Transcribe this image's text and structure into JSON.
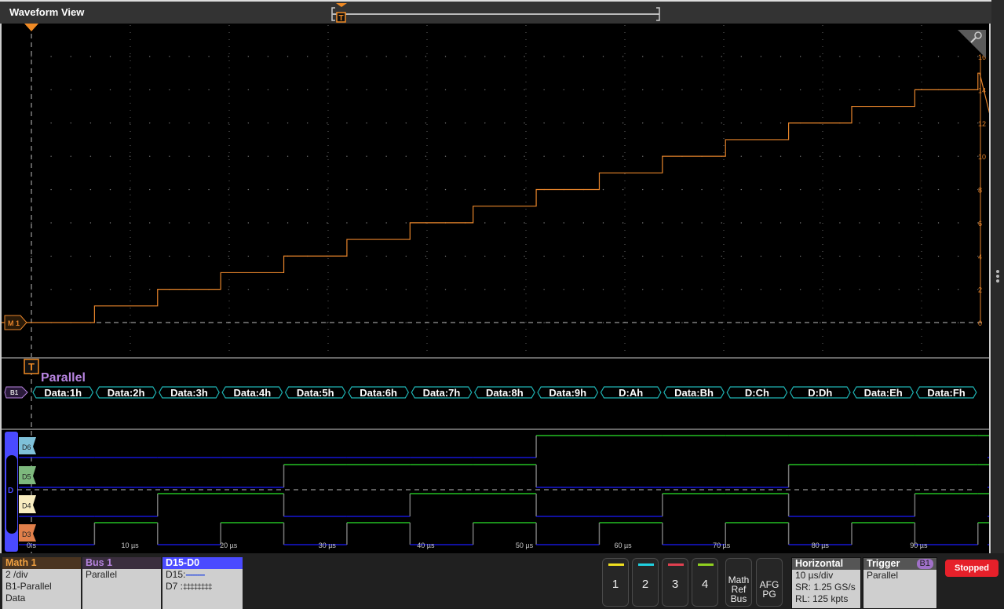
{
  "window": {
    "title": "Waveform View"
  },
  "colors": {
    "math": "#e8852b",
    "bus_label": "#b784e0",
    "bus_outline": "#1fb4b4",
    "digital_high": "#2be62b",
    "digital_low": "#1a1aff",
    "d_group": "#4a4aff"
  },
  "math_waveform": {
    "label": "M 1",
    "yaxis_ticks": [
      "0",
      "2",
      "4",
      "6",
      "8",
      "10",
      "12",
      "14",
      "16"
    ],
    "step_values": [
      0,
      1,
      2,
      3,
      4,
      5,
      6,
      7,
      8,
      9,
      10,
      11,
      12,
      13,
      14,
      15,
      0
    ],
    "step_period_us": 6.4,
    "start_us": 0
  },
  "bus": {
    "trigger_marker": "T",
    "title": "Parallel",
    "badge": "B1",
    "packets": [
      "Data:1h",
      "Data:2h",
      "Data:3h",
      "Data:4h",
      "Data:5h",
      "Data:6h",
      "Data:7h",
      "Data:8h",
      "Data:9h",
      "D:Ah",
      "Data:Bh",
      "D:Ch",
      "D:Dh",
      "Data:Eh",
      "Data:Fh"
    ]
  },
  "digital": {
    "group_label": "D",
    "channels": [
      {
        "name": "D6",
        "color": "#7ec0d8",
        "bit": 3
      },
      {
        "name": "D5",
        "color": "#7db87d",
        "bit": 2
      },
      {
        "name": "D4",
        "color": "#f8ecc0",
        "bit": 1
      },
      {
        "name": "D3",
        "color": "#e07f4a",
        "bit": 0
      }
    ]
  },
  "time_axis": {
    "labels": [
      "0 s",
      "10 µs",
      "20 µs",
      "30 µs",
      "40 µs",
      "50 µs",
      "60 µs",
      "70 µs",
      "80 µs",
      "90 µs"
    ],
    "us_per_div": 10
  },
  "badges": {
    "math": {
      "title": "Math 1",
      "lines": [
        "2 /div",
        "B1-Parallel",
        "Data"
      ]
    },
    "bus": {
      "title": "Bus 1",
      "lines": [
        "Parallel"
      ]
    },
    "digital": {
      "title": "D15-D0",
      "line1": "D15:",
      "line1_value": "--------",
      "line2": "D7 :",
      "line2_value": "‡‡‡‡‡‡‡‡"
    },
    "horizontal": {
      "title": "Horizontal",
      "lines": [
        "10 µs/div",
        "SR: 1.25 GS/s",
        "RL: 125 kpts"
      ]
    },
    "trigger": {
      "title": "Trigger",
      "badge": "B1",
      "lines": [
        "Parallel"
      ]
    }
  },
  "channel_buttons": [
    {
      "label": "1",
      "color": "#f0e020"
    },
    {
      "label": "2",
      "color": "#20d0e0"
    },
    {
      "label": "3",
      "color": "#e04050"
    },
    {
      "label": "4",
      "color": "#90d020"
    }
  ],
  "math_ref_bus_button": [
    "Math",
    "Ref",
    "Bus"
  ],
  "afg_button": [
    "AFG",
    "PG"
  ],
  "run_status": "Stopped"
}
